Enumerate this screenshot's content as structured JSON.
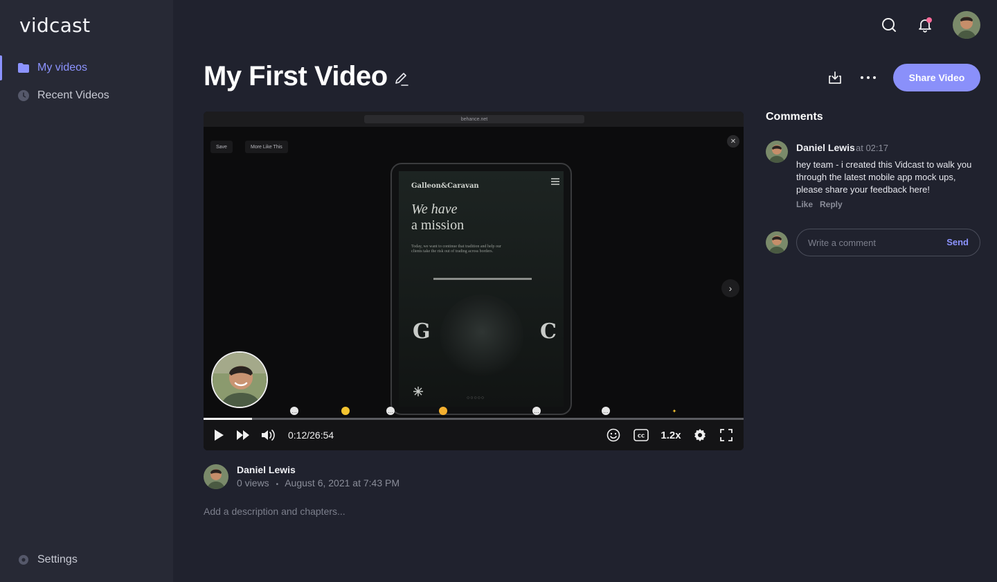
{
  "app": {
    "logo": "vidcast"
  },
  "sidebar": {
    "items": [
      {
        "label": "My videos",
        "icon": "folder-icon",
        "active": true
      },
      {
        "label": "Recent Videos",
        "icon": "clock-icon",
        "active": false
      }
    ],
    "settings_label": "Settings"
  },
  "header": {
    "search_icon": "search-icon",
    "bell_icon": "bell-icon",
    "notification_dot_color": "#ff6b9a"
  },
  "video": {
    "title": "My First Video",
    "share_label": "Share Video",
    "screen": {
      "url": "behance.net",
      "save_chip": "Save",
      "more_chip": "More Like This",
      "brand": "Galleon&Caravan",
      "headline_line1": "We have",
      "headline_line2": "a mission",
      "blurb": "Today, we want to continue that tradition and help our clients take the risk out of trading across borders.",
      "letter_left": "G",
      "letter_right": "C",
      "dots": "○○○○○"
    },
    "player": {
      "time": "0:12/26:54",
      "speed": "1.2x",
      "progress": 0.09
    }
  },
  "author": {
    "name": "Daniel Lewis",
    "views": "0 views",
    "date": "August 6, 2021 at 7:43 PM"
  },
  "description_placeholder": "Add a description and chapters...",
  "comments": {
    "title": "Comments",
    "items": [
      {
        "author": "Daniel Lewis",
        "timestamp": "at 02:17",
        "text": "hey team - i created this Vidcast to walk you through the latest mobile app mock ups, please share your feedback here!",
        "like": "Like",
        "reply": "Reply"
      }
    ],
    "input_placeholder": "Write a comment",
    "send_label": "Send"
  },
  "colors": {
    "accent": "#8c93ff",
    "button": "#8a90fa",
    "background": "#20222e",
    "sidebar": "#272935"
  }
}
